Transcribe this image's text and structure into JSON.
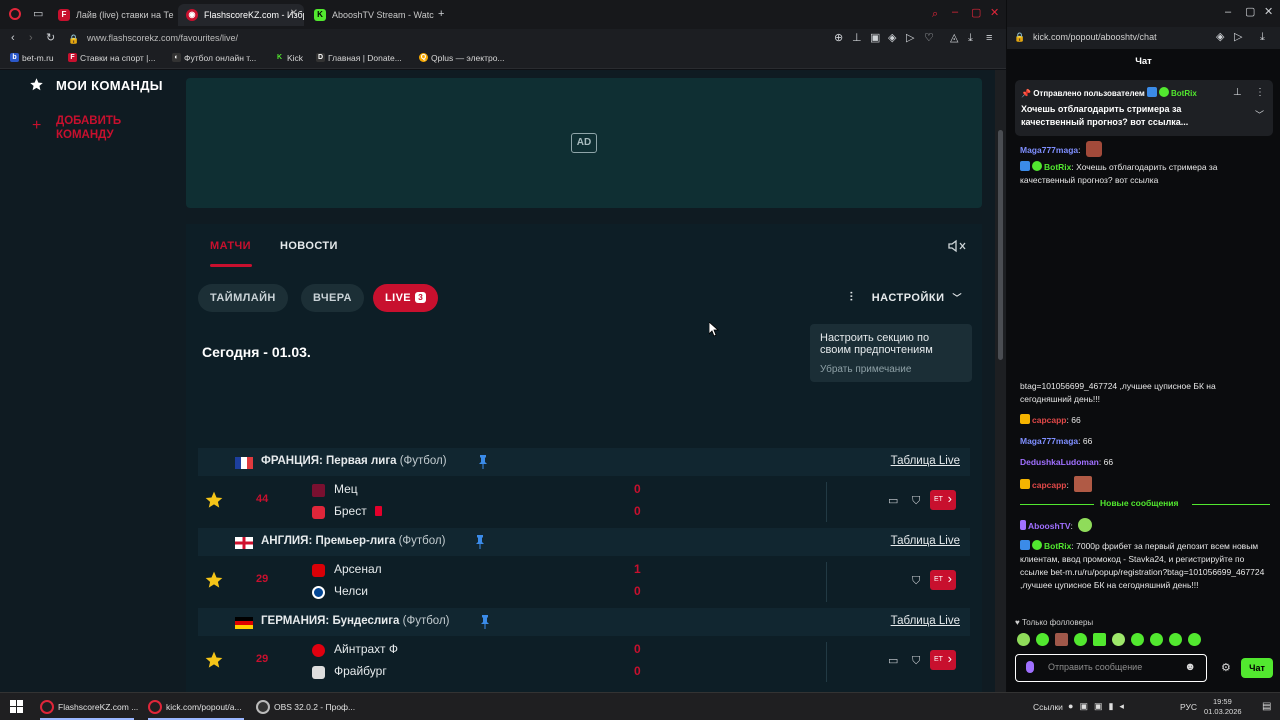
{
  "colors": {
    "accent": "#c8102e",
    "kick_green": "#52e82f",
    "panel": "#0d1e26"
  },
  "browser_left": {
    "tabs": [
      {
        "label": "Лайв (live) ставки на Тен",
        "icon": "flashscore-favicon"
      },
      {
        "label": "FlashscoreKZ.com - Избр",
        "icon": "flashscore-favicon"
      },
      {
        "label": "AbooshTV Stream - Watch",
        "icon": "kick-favicon"
      }
    ],
    "url": "www.flashscorekz.com/favourites/live/",
    "bookmarks": [
      {
        "label": "bet-m.ru",
        "icon": "betm-icon"
      },
      {
        "label": "Ставки на спорт |...",
        "icon": "flashscore-favicon"
      },
      {
        "label": "Футбол онлайн т...",
        "icon": "football-icon"
      },
      {
        "label": "Kick",
        "icon": "kick-favicon"
      },
      {
        "label": "Главная | Donate...",
        "icon": "donate-icon"
      },
      {
        "label": "Qplus — электро...",
        "icon": "qplus-icon"
      }
    ]
  },
  "sidebar": {
    "title": "МОИ КОМАНДЫ",
    "add_line1": "ДОБАВИТЬ",
    "add_line2": "КОМАНДУ"
  },
  "ad": {
    "label": "AD"
  },
  "panel": {
    "tabs": {
      "matches": "МАТЧИ",
      "news": "НОВОСТИ"
    },
    "filters": {
      "timeline": "ТАЙМЛАЙН",
      "yesterday": "ВЧЕРА",
      "live": "LIVE",
      "live_count": "3"
    },
    "settings_label": "НАСТРОЙКИ",
    "tooltip": {
      "text_line1": "Настроить секцию по",
      "text_line2": "своим предпочтениям",
      "dismiss": "Убрать примечание"
    },
    "date": "Сегодня - 01.03."
  },
  "leagues": [
    {
      "country": "ФРАНЦИЯ: Первая лига",
      "sport": "(Футбол)",
      "table_link": "Таблица Live",
      "match": {
        "minute": "44",
        "home": "Мец",
        "away": "Брест",
        "home_score": "0",
        "away_score": "0",
        "badge": "ET"
      }
    },
    {
      "country": "АНГЛИЯ: Премьер-лига",
      "sport": "(Футбол)",
      "table_link": "Таблица Live",
      "match": {
        "minute": "29",
        "home": "Арсенал",
        "away": "Челси",
        "home_score": "1",
        "away_score": "0",
        "badge": "ET"
      }
    },
    {
      "country": "ГЕРМАНИЯ: Бундеслига",
      "sport": "(Футбол)",
      "table_link": "Таблица Live",
      "match": {
        "minute": "29",
        "home": "Айнтрахт Ф",
        "away": "Фрайбург",
        "home_score": "0",
        "away_score": "0",
        "badge": "ET"
      }
    }
  ],
  "browser_right": {
    "url": "kick.com/popout/abooshtv/chat",
    "title": "Чат"
  },
  "chat": {
    "pinned": {
      "header": "Отправлено пользователем",
      "user": "BotRix",
      "text": "Хочешь отблагодарить стримера за качественный прогноз? вот ссылка..."
    },
    "messages_top": [
      {
        "user": "Maga777maga",
        "text": ":"
      },
      {
        "user": "BotRix",
        "text": ": Хочешь отблагодарить стримера за качественный прогноз? вот ссылка"
      }
    ],
    "cut_text_line1": "btag=101056699_467724 ,лучшее цуписное БК на",
    "cut_text_line2": "сегодняшний день!!!",
    "messages_mid": [
      {
        "user": "capcapp",
        "text": ": 66"
      },
      {
        "user": "Maga777maga",
        "text": ": 66"
      },
      {
        "user": "DedushkaLudoman",
        "text": ": 66"
      },
      {
        "user": "capcapp",
        "text": ":"
      }
    ],
    "new_messages": "Новые сообщения",
    "messages_bottom": [
      {
        "user": "AbooshTV",
        "text": ":"
      },
      {
        "user": "BotRix",
        "text": ": 7000р фрибет за первый депозит всем новым клиентам, ввод промокод - Stavka24, и регистрируйте по ссылке bet-m.ru/ru/popup/registration?btag=101056699_467724 ,лучшее цуписное БК на сегодняшний день!!!"
      }
    ],
    "followers_only": "Только фолловеры",
    "input_placeholder": "Отправить сообщение",
    "send_label": "Чат"
  },
  "taskbar": {
    "items": [
      {
        "label": "FlashscoreKZ.com ..."
      },
      {
        "label": "kick.com/popout/a..."
      },
      {
        "label": "OBS 32.0.2 - Проф..."
      }
    ],
    "tray_links": "Ссылки",
    "lang": "РУС",
    "time": "19:59",
    "date": "01.03.2026"
  }
}
